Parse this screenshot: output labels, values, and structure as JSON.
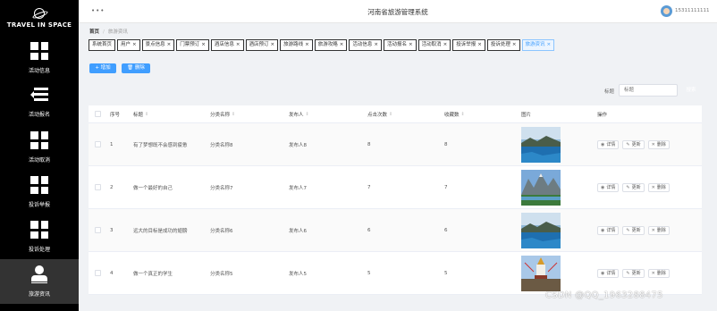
{
  "app": {
    "logo_text": "TRAVEL IN SPACE",
    "system_title": "河南省旅游管理系统",
    "username": "15311111111"
  },
  "sidebar": {
    "items": [
      {
        "label": "活动信息",
        "icon": "grid-icon"
      },
      {
        "label": "活动报名",
        "icon": "list-icon"
      },
      {
        "label": "活动取消",
        "icon": "grid-icon"
      },
      {
        "label": "投诉举报",
        "icon": "grid-icon"
      },
      {
        "label": "投诉处理",
        "icon": "grid-icon"
      },
      {
        "label": "旅游资讯",
        "icon": "user-icon",
        "active": true
      }
    ]
  },
  "breadcrumb": {
    "home": "首页",
    "separator": "/",
    "current": "旅游资讯"
  },
  "tabs": [
    {
      "label": "系统首页",
      "closable": false
    },
    {
      "label": "用户",
      "closable": true
    },
    {
      "label": "景点信息",
      "closable": true
    },
    {
      "label": "门票预订",
      "closable": true
    },
    {
      "label": "酒店信息",
      "closable": true
    },
    {
      "label": "酒店预订",
      "closable": true
    },
    {
      "label": "旅游路线",
      "closable": true
    },
    {
      "label": "旅游攻略",
      "closable": true
    },
    {
      "label": "活动信息",
      "closable": true
    },
    {
      "label": "活动报名",
      "closable": true
    },
    {
      "label": "活动取消",
      "closable": true
    },
    {
      "label": "投诉举报",
      "closable": true
    },
    {
      "label": "投诉处理",
      "closable": true
    },
    {
      "label": "旅游资讯",
      "closable": true,
      "active": true
    }
  ],
  "toolbar": {
    "add_label": "+ 增加",
    "delete_label": "🗑 删除"
  },
  "search": {
    "label": "标题",
    "placeholder": "标题",
    "button_label": "搜索"
  },
  "table": {
    "columns": [
      "序号",
      "标题",
      "分类名称",
      "发布人",
      "点击次数",
      "收藏数",
      "图片",
      "操作"
    ],
    "rows": [
      {
        "index": "1",
        "title": "有了梦想既不会感到疲惫",
        "category": "分类名称8",
        "publisher": "发布人8",
        "clicks": "8",
        "favorites": "8",
        "image": "lake"
      },
      {
        "index": "2",
        "title": "做一个最好的自己",
        "category": "分类名称7",
        "publisher": "发布人7",
        "clicks": "7",
        "favorites": "7",
        "image": "peaks"
      },
      {
        "index": "3",
        "title": "远大的目标是成功的翅膀",
        "category": "分类名称6",
        "publisher": "发布人6",
        "clicks": "6",
        "favorites": "6",
        "image": "lake"
      },
      {
        "index": "4",
        "title": "做一个真正的学生",
        "category": "分类名称5",
        "publisher": "发布人5",
        "clicks": "5",
        "favorites": "5",
        "image": "temple"
      }
    ],
    "actions": {
      "detail": "详情",
      "edit": "更新",
      "delete": "删除"
    }
  },
  "watermark": "CSDN @QQ_1963288475",
  "colors": {
    "sidebar_bg": "#000000",
    "primary": "#409eff",
    "active_nav": "#333333"
  }
}
